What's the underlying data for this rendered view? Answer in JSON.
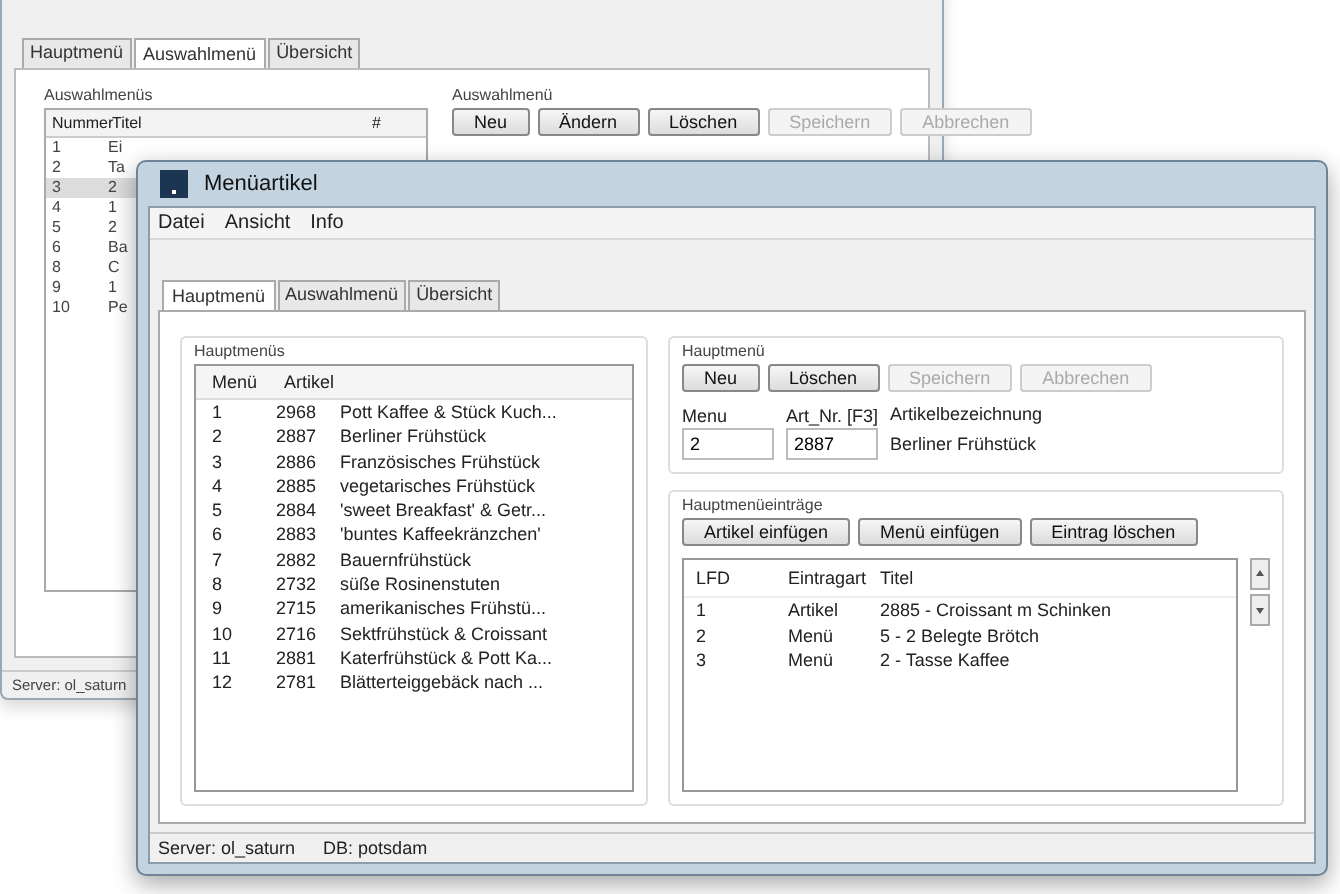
{
  "back_window": {
    "tabs": [
      {
        "label": "Hauptmenü",
        "selected": false
      },
      {
        "label": "Auswahlmenü",
        "selected": true
      },
      {
        "label": "Übersicht",
        "selected": false
      }
    ],
    "list_group": {
      "title": "Auswahlmenüs",
      "columns": [
        "Nummer",
        "Titel",
        "#"
      ],
      "rows": [
        {
          "cells": [
            "1",
            "Ei"
          ],
          "selected": false
        },
        {
          "cells": [
            "2",
            "Ta"
          ],
          "selected": false
        },
        {
          "cells": [
            "3",
            "2"
          ],
          "selected": true
        },
        {
          "cells": [
            "4",
            "1"
          ],
          "selected": false
        },
        {
          "cells": [
            "5",
            "2"
          ],
          "selected": false
        },
        {
          "cells": [
            "6",
            "Ba"
          ],
          "selected": false
        },
        {
          "cells": [
            "8",
            "C"
          ],
          "selected": false
        },
        {
          "cells": [
            "9",
            "1"
          ],
          "selected": false
        },
        {
          "cells": [
            "10",
            "Pe"
          ],
          "selected": false
        }
      ]
    },
    "button_group": {
      "title": "Auswahlmenü",
      "buttons": [
        {
          "label": "Neu",
          "disabled": false
        },
        {
          "label": "Ändern",
          "disabled": false
        },
        {
          "label": "Löschen",
          "disabled": false
        },
        {
          "label": "Speichern",
          "disabled": true
        },
        {
          "label": "Abbrechen",
          "disabled": true
        }
      ]
    },
    "status_bar": "Server: ol_saturn"
  },
  "window": {
    "title": "Menüartikel",
    "menu": [
      "Datei",
      "Ansicht",
      "Info"
    ],
    "tabs": [
      {
        "label": "Hauptmenü",
        "selected": true
      },
      {
        "label": "Auswahlmenü",
        "selected": false
      },
      {
        "label": "Übersicht",
        "selected": false
      }
    ],
    "menus_group": {
      "title": "Hauptmenüs",
      "columns": [
        "Menü",
        "Artikel"
      ],
      "rows": [
        [
          "1",
          "2968",
          "Pott Kaffee & Stück Kuch..."
        ],
        [
          "2",
          "2887",
          "Berliner Frühstück"
        ],
        [
          "3",
          "2886",
          "Französisches Frühstück"
        ],
        [
          "4",
          "2885",
          "vegetarisches Frühstück"
        ],
        [
          "5",
          "2884",
          "'sweet Breakfast' & Getr..."
        ],
        [
          "6",
          "2883",
          "'buntes Kaffeekränzchen'"
        ],
        [
          "7",
          "2882",
          "Bauernfrühstück"
        ],
        [
          "8",
          "2732",
          "süße Rosinenstuten"
        ],
        [
          "9",
          "2715",
          "amerikanisches Frühstü..."
        ],
        [
          "10",
          "2716",
          "Sektfrühstück & Croissant"
        ],
        [
          "11",
          "2881",
          "Katerfrühstück & Pott Ka..."
        ],
        [
          "12",
          "2781",
          "Blätterteiggebäck nach ..."
        ]
      ]
    },
    "editor_group": {
      "title": "Hauptmenü",
      "buttons": [
        {
          "label": "Neu",
          "disabled": false
        },
        {
          "label": "Löschen",
          "disabled": false
        },
        {
          "label": "Speichern",
          "disabled": true
        },
        {
          "label": "Abbrechen",
          "disabled": true
        }
      ],
      "fields": [
        {
          "label": "Menu",
          "value": "2"
        },
        {
          "label": "Art_Nr. [F3]",
          "value": "2887"
        }
      ],
      "description_label": "Artikelbezeichnung",
      "description": "Berliner Frühstück"
    },
    "entries_group": {
      "title": "Hauptmenüeinträge",
      "buttons": [
        "Artikel einfügen",
        "Menü einfügen",
        "Eintrag löschen"
      ],
      "columns": [
        "LFD",
        "Eintragart",
        "Titel"
      ],
      "rows": [
        [
          "1",
          "Artikel",
          "2885 - Croissant m Schinken"
        ],
        [
          "2",
          "Menü",
          "5 - 2 Belegte Brötch"
        ],
        [
          "3",
          "Menü",
          "2 - Tasse Kaffee"
        ]
      ]
    },
    "status_bar": [
      "Server: ol_saturn",
      "DB: potsdam"
    ]
  }
}
